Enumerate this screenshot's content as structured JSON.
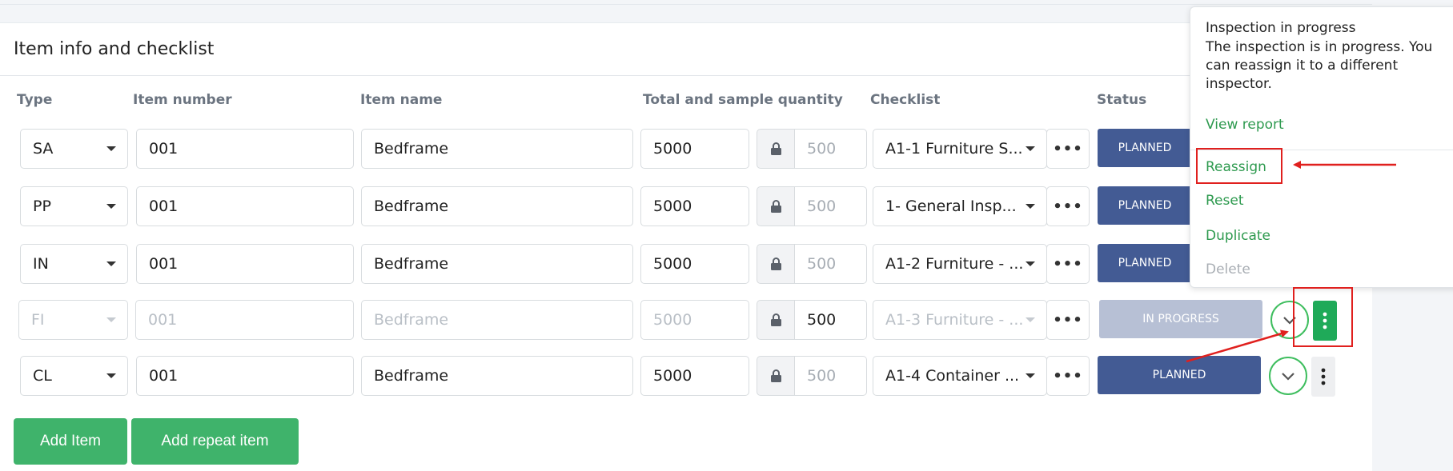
{
  "section_title": "Item info and checklist",
  "columns": {
    "type": "Type",
    "item_number": "Item number",
    "item_name": "Item name",
    "quantity": "Total and sample quantity",
    "checklist": "Checklist",
    "status": "Status"
  },
  "rows": [
    {
      "type": "SA",
      "item_number": "001",
      "item_name": "Bedframe",
      "total": "5000",
      "sample": "500",
      "checklist": "A1-1 Furniture S...",
      "status": "PLANNED",
      "disabled": false
    },
    {
      "type": "PP",
      "item_number": "001",
      "item_name": "Bedframe",
      "total": "5000",
      "sample": "500",
      "checklist": "1- General Insp...",
      "status": "PLANNED",
      "disabled": false
    },
    {
      "type": "IN",
      "item_number": "001",
      "item_name": "Bedframe",
      "total": "5000",
      "sample": "500",
      "checklist": "A1-2 Furniture - ...",
      "status": "PLANNED",
      "disabled": false
    },
    {
      "type": "FI",
      "item_number": "001",
      "item_name": "Bedframe",
      "total": "5000",
      "sample": "500",
      "checklist": "A1-3 Furniture - ...",
      "status": "IN PROGRESS",
      "disabled": true
    },
    {
      "type": "CL",
      "item_number": "001",
      "item_name": "Bedframe",
      "total": "5000",
      "sample": "500",
      "checklist": "A1-4 Container ...",
      "status": "PLANNED",
      "disabled": false
    }
  ],
  "buttons": {
    "add_item": "Add Item",
    "add_repeat_item": "Add repeat item"
  },
  "popover": {
    "title": "Inspection in progress",
    "body": "The inspection is in progress. You can reassign it to a different inspector.",
    "items": {
      "view_report": "View report",
      "reassign": "Reassign",
      "reset": "Reset",
      "duplicate": "Duplicate",
      "delete": "Delete"
    }
  },
  "colors": {
    "status_planned": "#435b94",
    "status_in_progress": "#b7c0d5",
    "accent_green": "#3fb36b",
    "highlight_red": "#e0201e"
  }
}
